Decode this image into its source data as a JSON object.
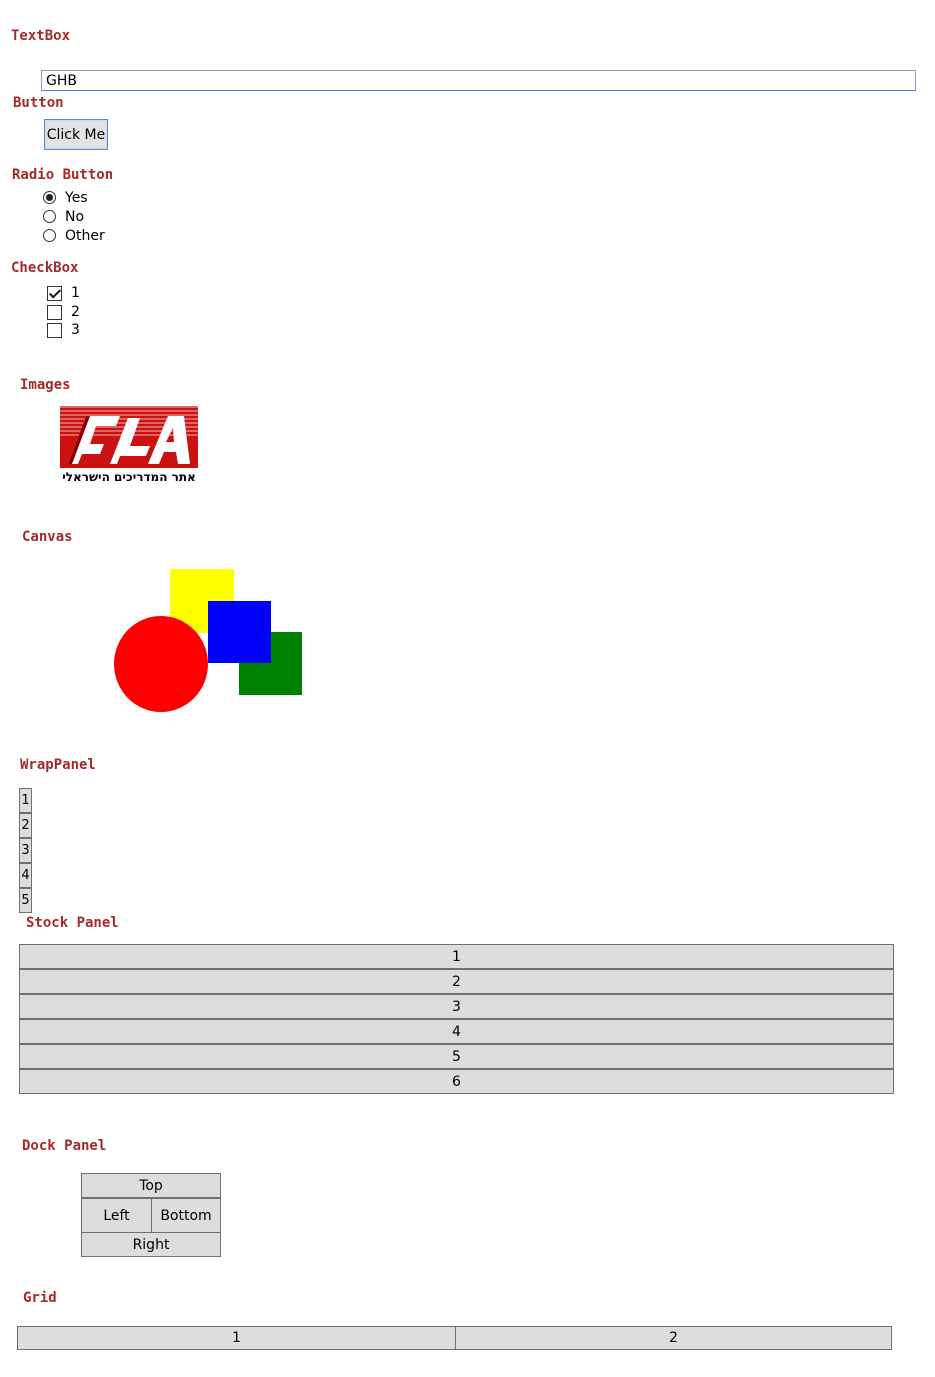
{
  "textbox": {
    "header": "TextBox",
    "value": "GHB"
  },
  "button": {
    "header": "Button",
    "label": "Click Me"
  },
  "radio": {
    "header": "Radio Button",
    "options": [
      {
        "label": "Yes",
        "checked": true
      },
      {
        "label": "No",
        "checked": false
      },
      {
        "label": "Other",
        "checked": false
      }
    ]
  },
  "checkbox": {
    "header": "CheckBox",
    "items": [
      {
        "label": "1",
        "checked": true
      },
      {
        "label": "2",
        "checked": false
      },
      {
        "label": "3",
        "checked": false
      }
    ]
  },
  "images": {
    "header": "Images",
    "logo_caption": "אתר המדריכים הישראלי",
    "logo_color": "#cc1111"
  },
  "canvas": {
    "header": "Canvas",
    "shapes": [
      {
        "kind": "rectangle",
        "color": "#ffff00"
      },
      {
        "kind": "rectangle",
        "color": "#0000ff"
      },
      {
        "kind": "rectangle",
        "color": "#008000"
      },
      {
        "kind": "ellipse",
        "color": "#ff0000"
      }
    ]
  },
  "wrap_panel": {
    "header": "WrapPanel",
    "buttons": [
      "1",
      "2",
      "3",
      "4",
      "5"
    ]
  },
  "stack_panel": {
    "header": "Stock Panel",
    "buttons": [
      "1",
      "2",
      "3",
      "4",
      "5",
      "6"
    ]
  },
  "dock_panel": {
    "header": "Dock Panel",
    "top": "Top",
    "left": "Left",
    "bottom": "Bottom",
    "right": "Right"
  },
  "grid": {
    "header": "Grid",
    "cells": [
      "1",
      "2"
    ]
  },
  "colors": {
    "header_text": "#a52a2a",
    "button_bg": "#dddddd",
    "button_border": "#707070"
  }
}
